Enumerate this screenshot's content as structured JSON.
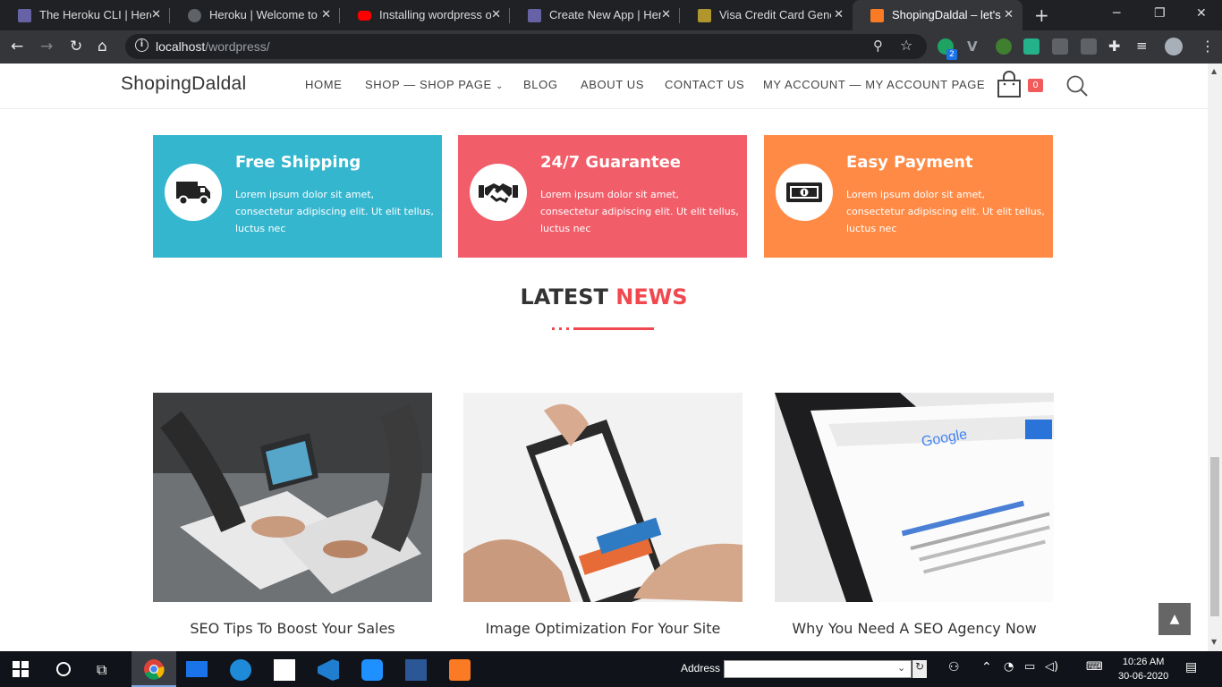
{
  "browser": {
    "tabs": [
      {
        "title": "The Heroku CLI | Herok",
        "icon": "heroku-icon",
        "color": "#6762a6"
      },
      {
        "title": "Heroku | Welcome to yo",
        "icon": "globe-icon",
        "color": "#5f6368"
      },
      {
        "title": "Installing wordpress on",
        "icon": "youtube-icon",
        "color": "#ff0000"
      },
      {
        "title": "Create New App | Herok",
        "icon": "heroku-icon",
        "color": "#6762a6"
      },
      {
        "title": "Visa Credit Card Genera",
        "icon": "card-icon",
        "color": "#b0962d"
      },
      {
        "title": "ShopingDaldal – let's go",
        "icon": "xampp-icon",
        "color": "#fb7a24"
      }
    ],
    "new_tab": "+",
    "url_host": "localhost",
    "url_path": "/wordpress/",
    "ext_badge": "2"
  },
  "site": {
    "logo": "ShopingDaldal",
    "nav": {
      "home": "HOME",
      "shop": "SHOP — SHOP PAGE",
      "blog": "BLOG",
      "about": "ABOUT US",
      "contact": "CONTACT US",
      "account": "MY ACCOUNT — MY ACCOUNT PAGE"
    },
    "cart_count": "0",
    "features": [
      {
        "title": "Free Shipping",
        "text": "Lorem ipsum dolor sit amet, consectetur adipiscing elit. Ut elit tellus, luctus nec",
        "color": "#35b6cf",
        "icon": "truck-icon"
      },
      {
        "title": "24/7 Guarantee",
        "text": "Lorem ipsum dolor sit amet, consectetur adipiscing elit. Ut elit tellus, luctus nec",
        "color": "#f15e6a",
        "icon": "handshake-icon"
      },
      {
        "title": "Easy Payment",
        "text": "Lorem ipsum dolor sit amet, consectetur adipiscing elit. Ut elit tellus, luctus nec",
        "color": "#ff8a45",
        "icon": "money-icon"
      }
    ],
    "news": {
      "title_part1": "LATEST ",
      "title_part2": "NEWS",
      "accent": "#f1484f",
      "posts": [
        {
          "title": "SEO Tips To Boost Your Sales"
        },
        {
          "title": "Image Optimization For Your Site"
        },
        {
          "title": "Why You Need A SEO Agency Now"
        }
      ]
    }
  },
  "taskbar": {
    "address_label": "Address",
    "time": "10:26 AM",
    "date": "30-06-2020"
  }
}
